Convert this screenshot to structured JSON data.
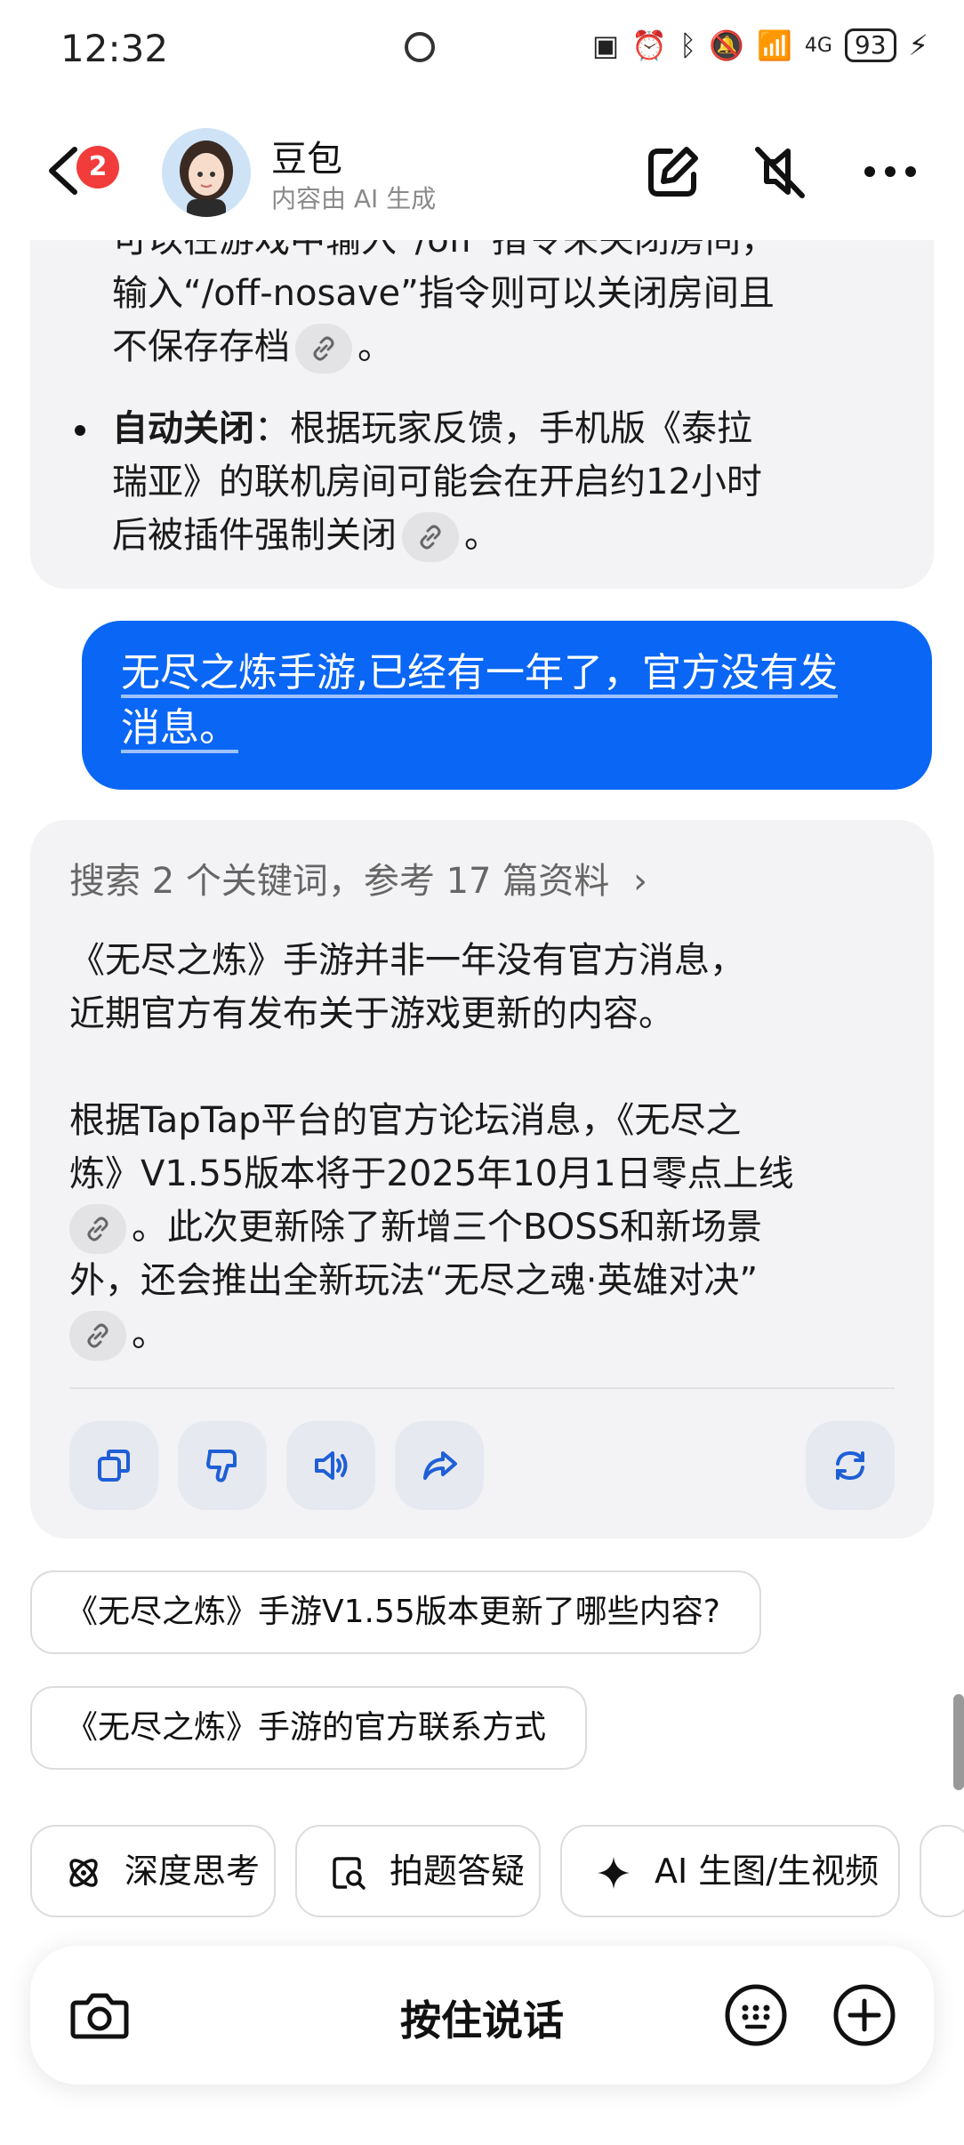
{
  "status_bar": {
    "time": "12:32",
    "battery": "93",
    "network": "4G"
  },
  "header": {
    "back_badge": "2",
    "title": "豆包",
    "subtitle": "内容由 AI 生成"
  },
  "ai_message_prev": {
    "line_partial": "可以在游戏中输入“/off”指令来关闭房间，",
    "line1": "输入“/off-nosave”指令则可以关闭房间且",
    "line2": "不保存存档",
    "line2_end": "。",
    "bullet_bold": "自动关闭",
    "bullet_rest_1": "：根据玩家反馈，手机版《泰拉",
    "bullet_line2": "瑞亚》的联机房间可能会在开启约12小时",
    "bullet_line3": "后被插件强制关闭",
    "bullet_end": "。"
  },
  "user_message": {
    "line1": "无尽之炼手游,已经有一年了，官方没有发",
    "line2": "消息。"
  },
  "ai_message": {
    "search_summary": "搜索 2 个关键词，参考 17 篇资料",
    "p1_line1": "《无尽之炼》手游并非一年没有官方消息，",
    "p1_line2": "近期官方有发布关于游戏更新的内容。",
    "p2_line1": "根据TapTap平台的官方论坛消息，《无尽之",
    "p2_line2": "炼》V1.55版本将于2025年10月1日零点上线",
    "p2_line3": "。此次更新除了新增三个BOSS和新场景",
    "p2_line4": "外，还会推出全新玩法“无尽之魂·英雄对决”",
    "p2_end": "。"
  },
  "suggestions": [
    "《无尽之炼》手游V1.55版本更新了哪些内容?",
    "《无尽之炼》手游的官方联系方式"
  ],
  "chips": [
    {
      "label": "深度思考",
      "icon": "atom-icon"
    },
    {
      "label": "拍题答疑",
      "icon": "search-doc-icon"
    },
    {
      "label": "AI 生图/生视频",
      "icon": "sparkle-icon"
    }
  ],
  "input_bar": {
    "hold_to_talk": "按住说话"
  },
  "colors": {
    "accent": "#0a66f5",
    "badge": "#f23b3b",
    "bubble_bg": "#f3f3f5"
  }
}
